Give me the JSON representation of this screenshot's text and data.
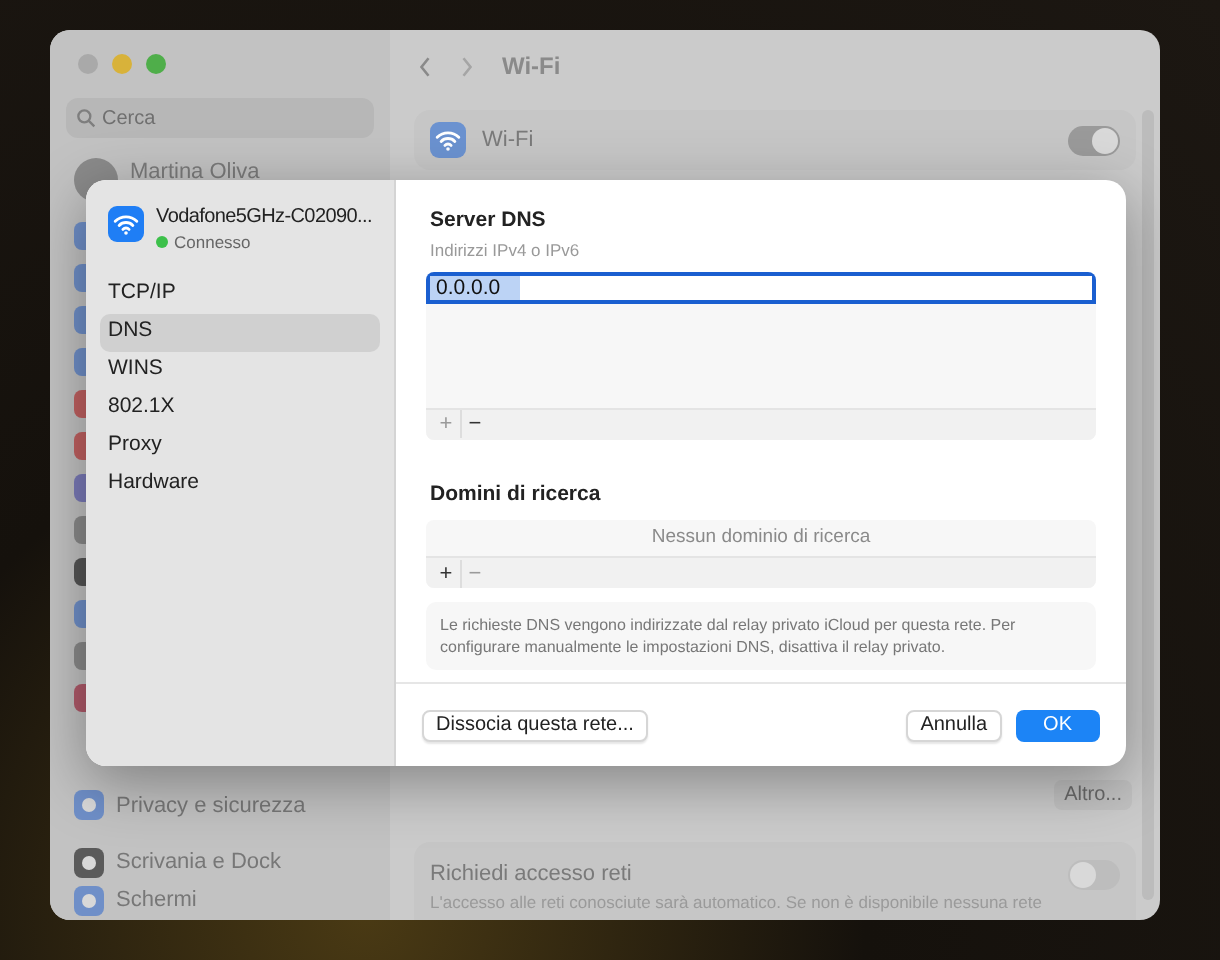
{
  "window": {
    "title": "Wi-Fi"
  },
  "sidebar": {
    "search_placeholder": "Cerca",
    "user": "Martina Oliva",
    "items": [
      {
        "label": "Privacy e sicurezza"
      },
      {
        "label": "Scrivania e Dock"
      },
      {
        "label": "Schermi"
      }
    ]
  },
  "main": {
    "wifi_row": {
      "label": "Wi-Fi",
      "on": true
    },
    "more_button": "Altro...",
    "ask_to_join": {
      "label": "Richiedi accesso reti",
      "description": "L'accesso alle reti conosciute sarà automatico. Se non è disponibile nessuna rete",
      "on": false
    }
  },
  "sheet": {
    "network": {
      "name": "Vodafone5GHz-C02090...",
      "status": "Connesso",
      "connected": true
    },
    "tabs": [
      {
        "label": "TCP/IP",
        "selected": false
      },
      {
        "label": "DNS",
        "selected": true
      },
      {
        "label": "WINS",
        "selected": false
      },
      {
        "label": "802.1X",
        "selected": false
      },
      {
        "label": "Proxy",
        "selected": false
      },
      {
        "label": "Hardware",
        "selected": false
      }
    ],
    "dns": {
      "title": "Server DNS",
      "subtitle": "Indirizzi IPv4 o IPv6",
      "servers": [
        {
          "value": "0.0.0.0",
          "selected": true
        }
      ],
      "controls": [
        {
          "label": "+",
          "disabled": true
        },
        {
          "label": "−",
          "disabled": false
        }
      ]
    },
    "search_domains": {
      "title": "Domini di ricerca",
      "placeholder": "Nessun dominio di ricerca",
      "controls": [
        {
          "label": "+",
          "disabled": false
        },
        {
          "label": "−",
          "disabled": true
        }
      ]
    },
    "info": "Le richieste DNS vengono indirizzate dal relay privato iCloud per questa rete. Per configurare manualmente le impostazioni DNS, disattiva il relay privato.",
    "buttons": [
      {
        "label": "Dissocia questa rete...",
        "kind": "secondary"
      },
      {
        "label": "Annulla",
        "kind": "secondary"
      },
      {
        "label": "OK",
        "kind": "primary"
      }
    ]
  }
}
